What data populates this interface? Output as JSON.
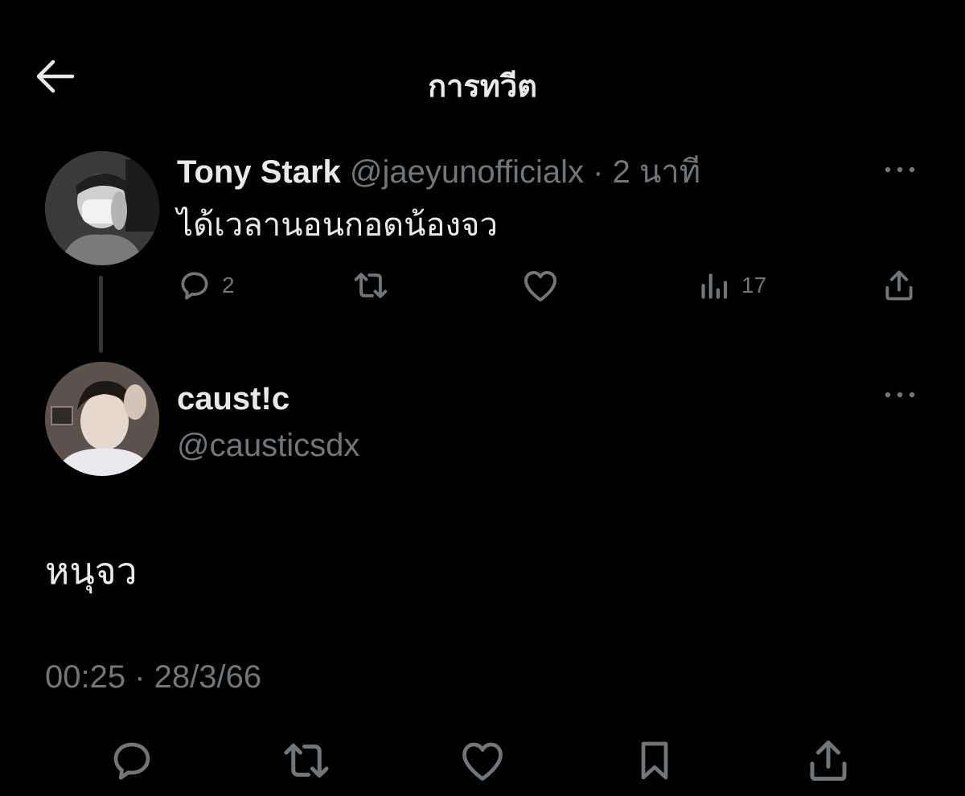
{
  "header": {
    "title": "การทวีต",
    "back_icon": "arrow-left-icon"
  },
  "parent_tweet": {
    "author_name": "Tony Stark",
    "handle": "@jaeyunofficialx",
    "separator": "·",
    "time_ago": "2 นาที",
    "text": "ได้เวลานอนกอดน้องจว",
    "actions": {
      "reply_count": "2",
      "retweet_count": "",
      "like_count": "",
      "view_count": "17"
    }
  },
  "reply_tweet": {
    "author_name": "caust!c",
    "handle": "@causticsdx",
    "text": "หนุจว",
    "timestamp": "00:25 · 28/3/66"
  },
  "colors": {
    "background": "#000000",
    "primary_text": "#e7e9ea",
    "secondary_text": "#71767b",
    "thread_line": "#333639"
  }
}
